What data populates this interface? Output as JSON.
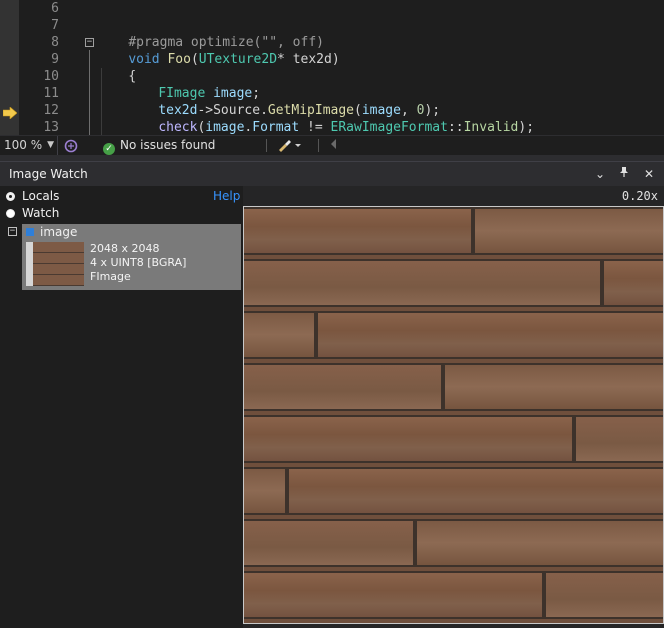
{
  "editor": {
    "line_numbers": [
      "6",
      "7",
      "8",
      "9",
      "10",
      "11",
      "12",
      "13"
    ],
    "lines": {
      "l7": {
        "pragma": "#pragma optimize(\"\", off)"
      },
      "l8": {
        "kw": "void",
        "fn": "Foo",
        "paren": "(",
        "type": "UTexture2D",
        "rest": "* tex2d)"
      },
      "l9": {
        "brace": "{"
      },
      "l10": {
        "type": "FImage",
        "sp": " ",
        "var": "image",
        "end": ";"
      },
      "l11": {
        "var1": "tex2d",
        "arrow": "->",
        "member": "Source",
        "dot": ".",
        "fn": "GetMipImage",
        "open": "(",
        "var2": "image",
        "comma": ", ",
        "num": "0",
        "close": ");"
      },
      "l12": {
        "macro": "check",
        "open": "(",
        "var": "image",
        "dot": ".",
        "member": "Format",
        "op": " != ",
        "enumtype": "ERawImageFormat",
        "scope": "::",
        "enumval": "Invalid",
        "close": ");"
      }
    }
  },
  "status_bar": {
    "zoom": "100 %",
    "issues": "No issues found",
    "ok_glyph": "✓"
  },
  "image_watch": {
    "title": "Image Watch",
    "buttons": {
      "dropdown": "⌄",
      "pin": "📌",
      "close": "✕"
    },
    "radios": [
      {
        "label": "Locals",
        "selected": true
      },
      {
        "label": "Watch",
        "selected": false
      }
    ],
    "help": "Help",
    "tree_toggle": "−",
    "variable": {
      "name": "image",
      "dimensions": "2048 x 2048",
      "format": "4 x UINT8 [BGRA]",
      "type": "FImage"
    },
    "zoom_factor": "0.20x"
  },
  "colors": {
    "accent": "#3794ff",
    "wood": "#7d5a45",
    "seam": "#3d322b"
  }
}
